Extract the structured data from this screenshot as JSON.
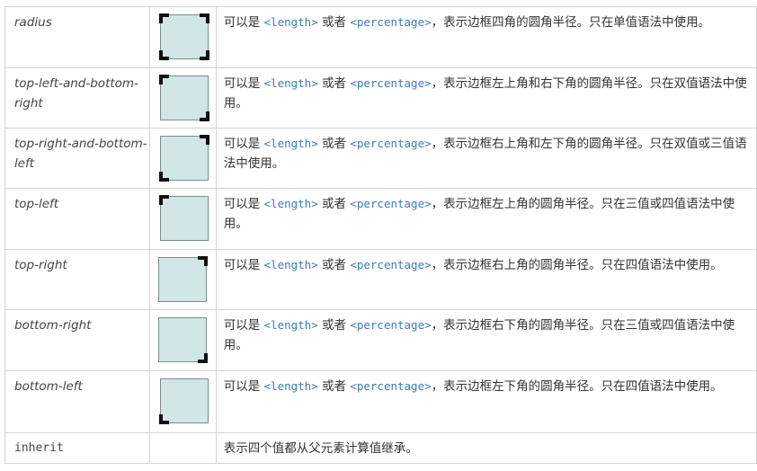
{
  "rows": [
    {
      "name": "radius",
      "desc_prefix": "可以是 ",
      "code1": "<length>",
      "mid": " 或者 ",
      "code2": "<percentage>",
      "desc_suffix": "，表示边框四角的圆角半径。只在单值语法中使用。",
      "corners": [
        "tl",
        "tr",
        "br",
        "bl"
      ]
    },
    {
      "name": "top-left-and-bottom-right",
      "desc_prefix": "可以是 ",
      "code1": "<length>",
      "mid": " 或者 ",
      "code2": "<percentage>",
      "desc_suffix": "，表示边框左上角和右下角的圆角半径。只在双值语法中使用。",
      "corners": [
        "tl",
        "br"
      ]
    },
    {
      "name": "top-right-and-bottom-left",
      "desc_prefix": "可以是 ",
      "code1": "<length>",
      "mid": " 或者 ",
      "code2": "<percentage>",
      "desc_suffix": "，表示边框右上角和左下角的圆角半径。只在双值或三值语法中使用。",
      "corners": [
        "tr",
        "bl"
      ]
    },
    {
      "name": "top-left",
      "desc_prefix": "可以是 ",
      "code1": "<length>",
      "mid": " 或者 ",
      "code2": "<percentage>",
      "desc_suffix": "，表示边框左上角的圆角半径。只在三值或四值语法中使用。",
      "corners": [
        "tl"
      ]
    },
    {
      "name": "top-right",
      "desc_prefix": "可以是 ",
      "code1": "<length>",
      "mid": " 或者 ",
      "code2": "<percentage>",
      "desc_suffix": "，表示边框右上角的圆角半径。只在四值语法中使用。",
      "corners": [
        "tr"
      ]
    },
    {
      "name": "bottom-right",
      "desc_prefix": "可以是 ",
      "code1": "<length>",
      "mid": " 或者 ",
      "code2": "<percentage>",
      "desc_suffix": "，表示边框右下角的圆角半径。只在三值或四值语法中使用。",
      "corners": [
        "br"
      ]
    },
    {
      "name": "bottom-left",
      "desc_prefix": "可以是 ",
      "code1": "<length>",
      "mid": " 或者 ",
      "code2": "<percentage>",
      "desc_suffix": "，表示边框左下角的圆角半径。只在四值语法中使用。",
      "corners": [
        "bl"
      ]
    }
  ],
  "inherit_row": {
    "name": "inherit",
    "desc": "表示四个值都从父元素计算值继承。"
  },
  "colors": {
    "code": "#3d7ab8",
    "box_fill": "#d1e6e6",
    "box_border": "#7c8c8c",
    "corner_mark": "#111111"
  }
}
